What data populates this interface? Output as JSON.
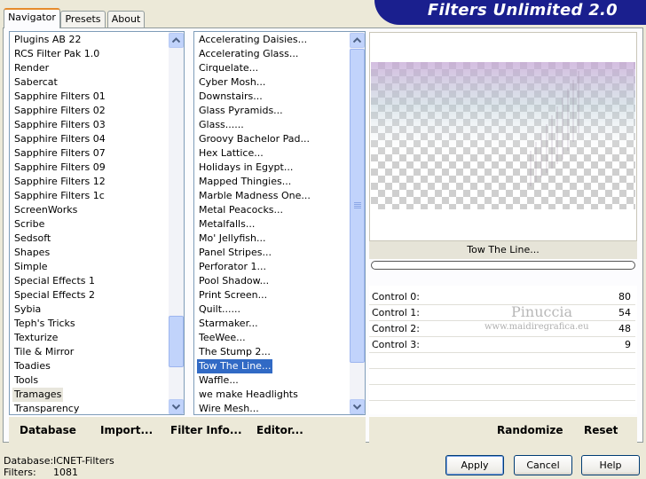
{
  "tabs": [
    {
      "label": "Navigator"
    },
    {
      "label": "Presets"
    },
    {
      "label": "About"
    }
  ],
  "title": "Filters Unlimited 2.0",
  "categories": {
    "items": [
      "Plugins AB 22",
      "RCS Filter Pak 1.0",
      "Render",
      "Sabercat",
      "Sapphire Filters 01",
      "Sapphire Filters 02",
      "Sapphire Filters 03",
      "Sapphire Filters 04",
      "Sapphire Filters 07",
      "Sapphire Filters 09",
      "Sapphire Filters 12",
      "Sapphire Filters 1c",
      "ScreenWorks",
      "Scribe",
      "Sedsoft",
      "Shapes",
      "Simple",
      "Special Effects 1",
      "Special Effects 2",
      "Sybia",
      "Teph's Tricks",
      "Texturize",
      "Tile & Mirror",
      "Toadies",
      "Tools",
      "Tramages",
      "Transparency"
    ],
    "highlighted": "Tramages"
  },
  "filters": {
    "items": [
      "Accelerating Daisies...",
      "Accelerating Glass...",
      "Cirquelate...",
      "Cyber Mosh...",
      "Downstairs...",
      "Glass Pyramids...",
      "Glass......",
      "Groovy Bachelor Pad...",
      "Hex Lattice...",
      "Holidays in Egypt...",
      "Mapped Thingies...",
      "Marble Madness One...",
      "Metal Peacocks...",
      "Metalfalls...",
      "Mo' Jellyfish...",
      "Panel Stripes...",
      "Perforator 1...",
      "Pool Shadow...",
      "Print Screen...",
      "Quilt......",
      "Starmaker...",
      "TeeWee...",
      "The Stump 2...",
      "Tow The Line...",
      "Waffle...",
      "we make Headlights",
      "Wire Mesh..."
    ],
    "selected": "Tow The Line..."
  },
  "preview": {
    "filter_name": "Tow The Line..."
  },
  "controls": [
    {
      "label": "Control 0:",
      "value": "80"
    },
    {
      "label": "Control 1:",
      "value": "54"
    },
    {
      "label": "Control 2:",
      "value": "48"
    },
    {
      "label": "Control 3:",
      "value": "9"
    }
  ],
  "watermark": {
    "name": "Pinuccia",
    "url": "www.maidiregrafica.eu"
  },
  "bottom_left": {
    "database": "Database",
    "import": "Import...",
    "filter_info": "Filter Info...",
    "editor": "Editor..."
  },
  "bottom_right": {
    "randomize": "Randomize",
    "reset": "Reset"
  },
  "status": {
    "database_label": "Database:",
    "database_value": "ICNET-Filters",
    "filters_label": "Filters:",
    "filters_value": "1081"
  },
  "buttons": {
    "apply": "Apply",
    "cancel": "Cancel",
    "help": "Help"
  },
  "colors": {
    "accent": "#1a1f8e",
    "selection": "#316ac5",
    "tab_highlight": "#e68b2c"
  }
}
